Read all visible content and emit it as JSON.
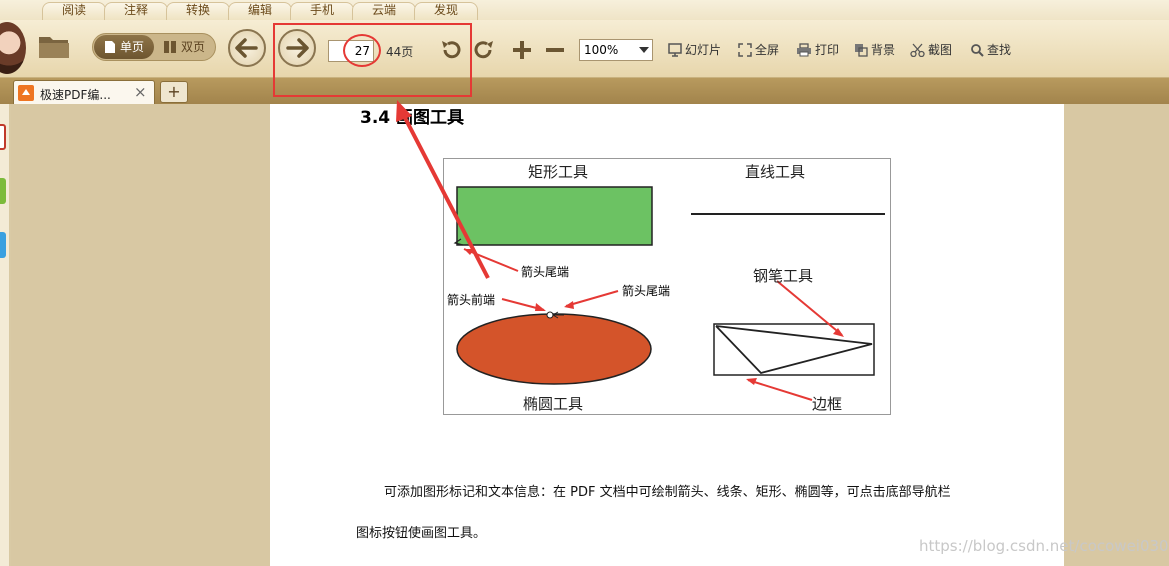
{
  "menu_tabs": [
    "阅读",
    "注释",
    "转换",
    "编辑",
    "手机",
    "云端",
    "发现"
  ],
  "toolbar": {
    "single_page_label": "单页",
    "double_page_label": "双页",
    "current_page": "27",
    "total_pages": "44页",
    "zoom": "100%",
    "slideshow_label": "幻灯片",
    "fullscreen_label": "全屏",
    "print_label": "打印",
    "background_label": "背景",
    "screenshot_label": "截图",
    "find_label": "查找"
  },
  "document_tab": {
    "title": "极速PDF编...",
    "close_glyph": "×",
    "new_tab_glyph": "+"
  },
  "document": {
    "section_heading": "3.4 画图工具",
    "figure": {
      "rect_tool": "矩形工具",
      "line_tool": "直线工具",
      "pen_tool": "钢笔工具",
      "ellipse_tool": "椭圆工具",
      "arrow_tail_1": "箭头尾端",
      "arrow_head": "箭头前端",
      "arrow_tail_2": "箭头尾端",
      "border": "边框"
    },
    "paragraph_1": "可添加图形标记和文本信息：在 PDF 文档中可绘制箭头、线条、矩形、椭圆等，可点击底部导航栏",
    "paragraph_2": "图标按钮使画图工具。"
  },
  "watermark": "https://blog.csdn.net/cocowei0306",
  "colors": {
    "highlight": "#e53935",
    "rect_fill": "#6cc263",
    "ellipse_fill": "#d4542a",
    "toolbar_bg": "#efe3c2"
  }
}
